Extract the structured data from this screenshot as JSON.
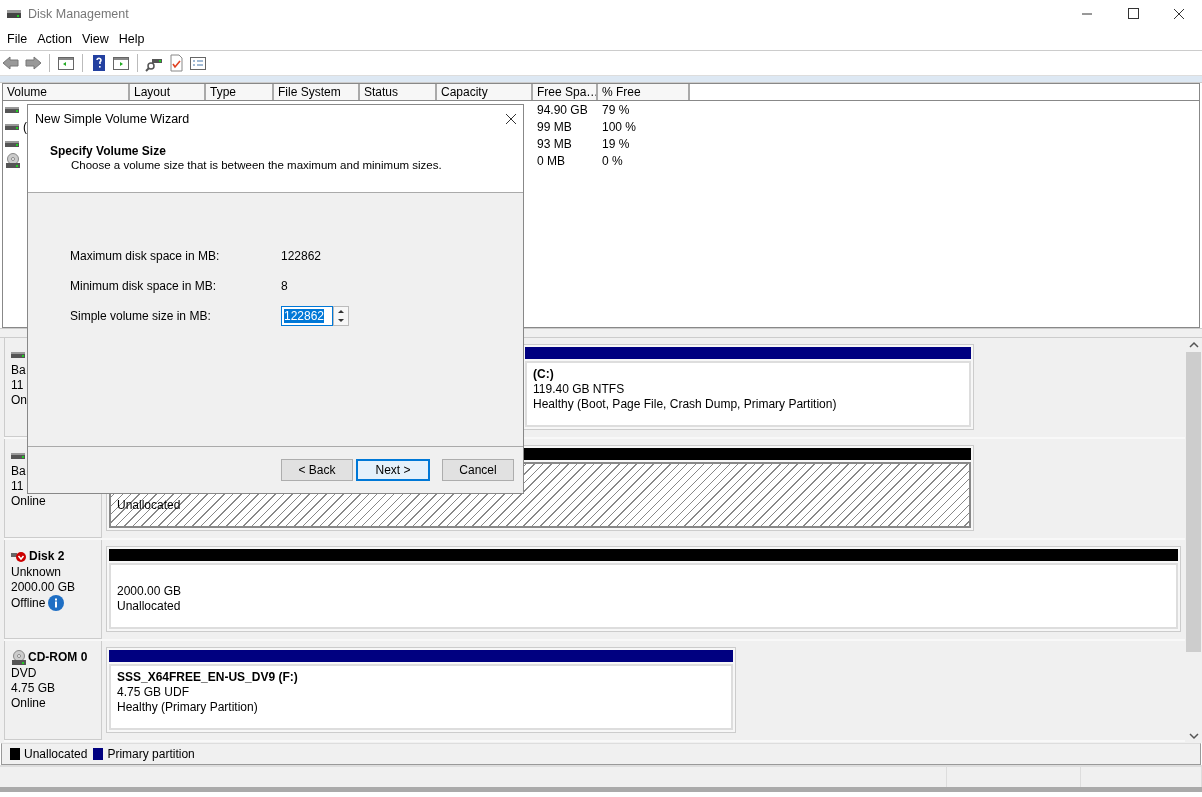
{
  "window": {
    "title": "Disk Management"
  },
  "menu": [
    {
      "label": "File"
    },
    {
      "label": "Action"
    },
    {
      "label": "View"
    },
    {
      "label": "Help"
    }
  ],
  "volume_list": {
    "columns": [
      "Volume",
      "Layout",
      "Type",
      "File System",
      "Status",
      "Capacity",
      "Free Spa…",
      "% Free"
    ],
    "rows": [
      {
        "kind": "disk",
        "free_space": "94.90 GB",
        "percent_free": "79 %"
      },
      {
        "kind": "disk",
        "volume": "(",
        "free_space": "99 MB",
        "percent_free": "100 %"
      },
      {
        "kind": "disk",
        "free_space": "93 MB",
        "percent_free": "19 %"
      },
      {
        "kind": "cdrom",
        "free_space": "0 MB",
        "percent_free": "0 %"
      }
    ]
  },
  "disks": [
    {
      "kind": "disk",
      "lines": [
        "Ba",
        "11",
        "On"
      ],
      "partitions": [
        {
          "kind": "primary",
          "selected": false,
          "name": "(C:)",
          "size": "119.40 GB NTFS",
          "status": "Healthy (Boot, Page File, Crash Dump, Primary Partition)"
        }
      ]
    },
    {
      "kind": "disk",
      "lines": [
        "Ba",
        "11",
        "Online"
      ],
      "partitions": [
        {
          "kind": "unallocated",
          "selected": true,
          "status": "Unallocated"
        }
      ]
    },
    {
      "kind": "offline",
      "name": "Disk 2",
      "lines": [
        "Unknown",
        "2000.00 GB",
        "Offline"
      ],
      "info": true,
      "partitions": [
        {
          "kind": "unallocated",
          "selected": false,
          "size": "2000.00 GB",
          "status": "Unallocated"
        }
      ]
    },
    {
      "kind": "cdrom",
      "name": "CD-ROM 0",
      "lines": [
        "DVD",
        "4.75 GB",
        "Online"
      ],
      "partitions": [
        {
          "kind": "primary",
          "selected": false,
          "name": "SSS_X64FREE_EN-US_DV9  (F:)",
          "size": "4.75 GB UDF",
          "status": "Healthy (Primary Partition)"
        }
      ]
    }
  ],
  "legend": [
    {
      "label": "Unallocated",
      "color": "#000000"
    },
    {
      "label": "Primary partition",
      "color": "#000080"
    }
  ],
  "dialog": {
    "title": "New Simple Volume Wizard",
    "heading": "Specify Volume Size",
    "subtitle": "Choose a volume size that is between the maximum and minimum sizes.",
    "fields": [
      {
        "kind": "text",
        "label": "Maximum disk space in MB:",
        "value": "122862"
      },
      {
        "kind": "text",
        "label": "Minimum disk space in MB:",
        "value": "8"
      },
      {
        "kind": "spin",
        "label": "Simple volume size in MB:",
        "value": "122862",
        "selected": true
      }
    ],
    "buttons": [
      {
        "label": "< Back",
        "default": false
      },
      {
        "label": "Next >",
        "default": true
      },
      {
        "label": "Cancel",
        "default": false
      }
    ]
  }
}
